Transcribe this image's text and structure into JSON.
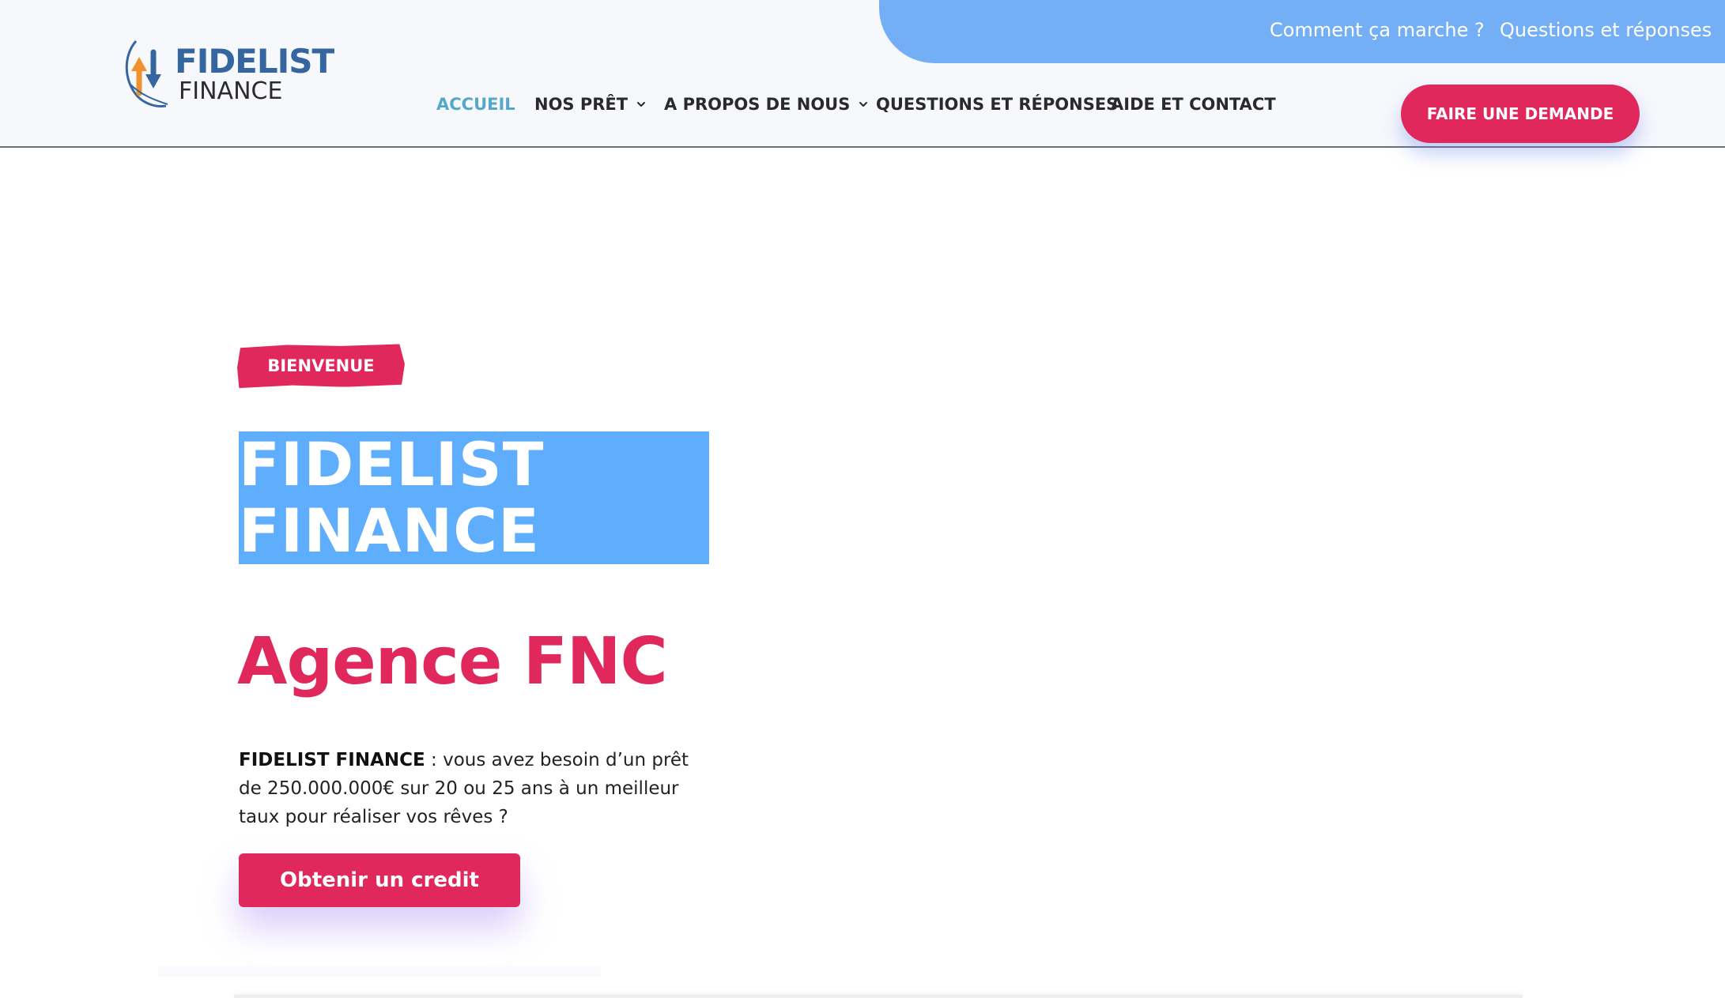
{
  "brand": {
    "logo_line1": "FIDELIST",
    "logo_line2": "FINANCE",
    "logo_icon": "arrows-cycle-icon",
    "colors": {
      "primary": "#e0285c",
      "accent_blue": "#74aff5",
      "title_highlight": "#5eaefd",
      "nav_active": "#55a8c8",
      "logo_blue": "#35669f"
    }
  },
  "topbar": {
    "link_how": "Comment ça marche ?",
    "link_faq": "Questions et réponses"
  },
  "nav": {
    "items": [
      {
        "label": "ACCUEIL",
        "active": true
      },
      {
        "label": "NOS PRÊT",
        "has_dropdown": true
      },
      {
        "label": "A PROPOS DE NOUS",
        "has_dropdown": true
      },
      {
        "label": "QUESTIONS ET RÉPONSES"
      },
      {
        "label": "AIDE ET CONTACT"
      }
    ],
    "cta": "FAIRE UNE DEMANDE"
  },
  "hero": {
    "badge": "BIENVENUE",
    "title_line1": "FIDELIST",
    "title_line2": "FINANCE",
    "subtitle": "Agence FNC",
    "desc_bold": "FIDELIST FINANCE",
    "desc_text": " : vous avez besoin d’un prêt de 250.000.000€ sur 20 ou 25 ans à un meilleur taux pour réaliser vos rêves ?",
    "cta": "Obtenir un credit"
  }
}
